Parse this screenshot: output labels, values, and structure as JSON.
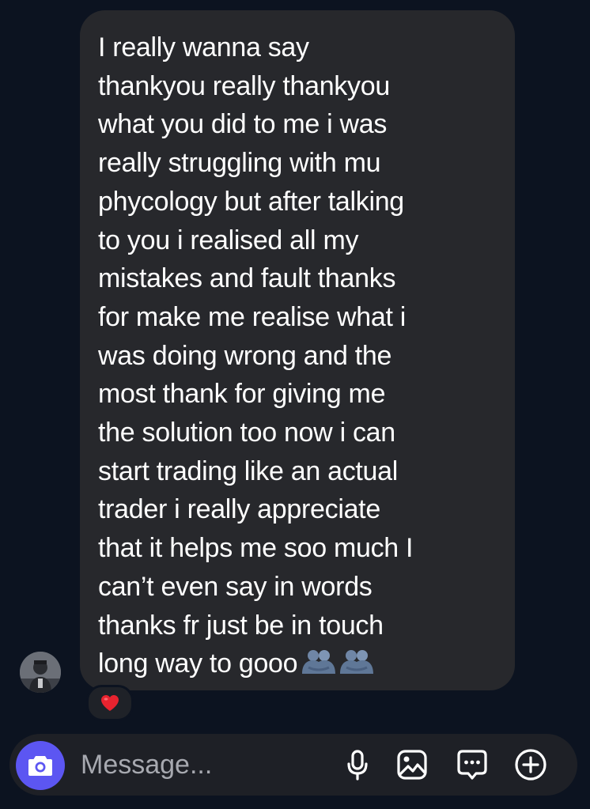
{
  "message": {
    "text": "I really wanna say\nthankyou really thankyou\nwhat you did to me i was\nreally struggling with mu\nphycology but after talking\nto you i realised all my\nmistakes and fault thanks\nfor make me realise what i\nwas doing wrong and the\nmost thank for giving me\nthe solution too now i can\nstart trading like an actual\ntrader i really appreciate\nthat it helps me soo much I\ncan’t even say in words\nthanks fr just be in touch\nlong way to gooo",
    "trailing_emoji": [
      "people-hugging-emoji",
      "people-hugging-emoji"
    ],
    "reaction": "red-heart-emoji"
  },
  "composer": {
    "placeholder": "Message..."
  },
  "icons": {
    "camera": "camera-icon",
    "microphone": "microphone-icon",
    "gallery": "image-icon",
    "sticker": "chat-bubble-icon",
    "more": "plus-circle-icon"
  },
  "colors": {
    "background": "#0c1320",
    "bubble": "#27282c",
    "camera_accent": "#5c56f2",
    "heart": "#e8232f",
    "placeholder": "#a7a9b0"
  }
}
